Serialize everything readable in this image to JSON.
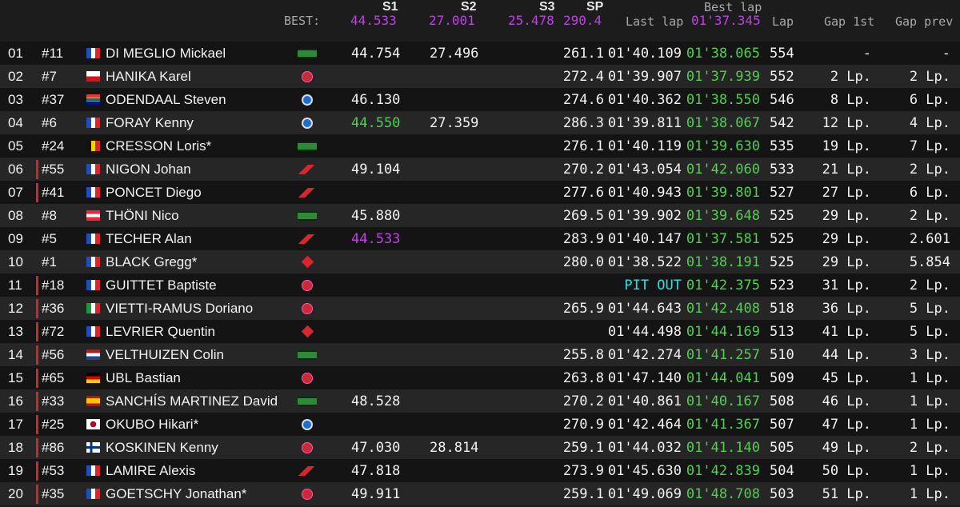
{
  "header": {
    "best_label": "BEST:",
    "s1": {
      "label": "S1",
      "best": "44.533"
    },
    "s2": {
      "label": "S2",
      "best": "27.001"
    },
    "s3": {
      "label": "S3",
      "best": "25.478"
    },
    "sp": {
      "label": "SP",
      "best": "290.4"
    },
    "last_lap_label": "Last lap",
    "best_lap": {
      "label": "Best lap",
      "value": "01'37.345"
    },
    "lap_label": "Lap",
    "gap1_label": "Gap 1st",
    "gapprev_label": "Gap prev"
  },
  "colors": {
    "purple": "#c040e8",
    "green": "#4fd04f",
    "cyan": "#2fe0e0",
    "red_bar": "#d0262a"
  },
  "rows": [
    {
      "pos": "01",
      "num": "#11",
      "red": false,
      "flag": "fr",
      "name": "DI MEGLIO Mickael",
      "brand": "kawasaki",
      "s1": "44.754",
      "s1c": "",
      "s2": "27.496",
      "sp": "261.1",
      "last": "01'40.109",
      "lastc": "",
      "best": "01'38.065",
      "lap": "554",
      "g1": "-",
      "gp": "-"
    },
    {
      "pos": "02",
      "num": "#7",
      "red": false,
      "flag": "cz",
      "name": "HANIKA Karel",
      "brand": "yamaha",
      "s1": "",
      "s1c": "",
      "s2": "",
      "sp": "272.4",
      "last": "01'39.907",
      "lastc": "",
      "best": "01'37.939",
      "lap": "552",
      "g1": "2 Lp.",
      "gp": "2 Lp."
    },
    {
      "pos": "03",
      "num": "#37",
      "red": false,
      "flag": "za",
      "name": "ODENDAAL Steven",
      "brand": "bmw",
      "s1": "46.130",
      "s1c": "",
      "s2": "",
      "sp": "274.6",
      "last": "01'40.362",
      "lastc": "",
      "best": "01'38.550",
      "lap": "546",
      "g1": "8 Lp.",
      "gp": "6 Lp."
    },
    {
      "pos": "04",
      "num": "#6",
      "red": false,
      "flag": "fr",
      "name": "FORAY Kenny",
      "brand": "bmw",
      "s1": "44.550",
      "s1c": "green",
      "s2": "27.359",
      "sp": "286.3",
      "last": "01'39.811",
      "lastc": "",
      "best": "01'38.067",
      "lap": "542",
      "g1": "12 Lp.",
      "gp": "4 Lp."
    },
    {
      "pos": "05",
      "num": "#24",
      "red": false,
      "flag": "be",
      "name": "CRESSON Loris*",
      "brand": "kawasaki",
      "s1": "",
      "s1c": "",
      "s2": "",
      "sp": "276.1",
      "last": "01'40.119",
      "lastc": "",
      "best": "01'39.630",
      "lap": "535",
      "g1": "19 Lp.",
      "gp": "7 Lp."
    },
    {
      "pos": "06",
      "num": "#55",
      "red": true,
      "flag": "fr",
      "name": "NIGON Johan",
      "brand": "honda",
      "s1": "49.104",
      "s1c": "",
      "s2": "",
      "sp": "270.2",
      "last": "01'43.054",
      "lastc": "",
      "best": "01'42.060",
      "lap": "533",
      "g1": "21 Lp.",
      "gp": "2 Lp."
    },
    {
      "pos": "07",
      "num": "#41",
      "red": true,
      "flag": "fr",
      "name": "PONCET Diego",
      "brand": "honda",
      "s1": "",
      "s1c": "",
      "s2": "",
      "sp": "277.6",
      "last": "01'40.943",
      "lastc": "",
      "best": "01'39.801",
      "lap": "527",
      "g1": "27 Lp.",
      "gp": "6 Lp."
    },
    {
      "pos": "08",
      "num": "#8",
      "red": false,
      "flag": "at",
      "name": "THÖNI Nico",
      "brand": "kawasaki",
      "s1": "45.880",
      "s1c": "",
      "s2": "",
      "sp": "269.5",
      "last": "01'39.902",
      "lastc": "",
      "best": "01'39.648",
      "lap": "525",
      "g1": "29 Lp.",
      "gp": "2 Lp."
    },
    {
      "pos": "09",
      "num": "#5",
      "red": false,
      "flag": "fr",
      "name": "TECHER Alan",
      "brand": "honda",
      "s1": "44.533",
      "s1c": "purple",
      "s2": "",
      "sp": "283.9",
      "last": "01'40.147",
      "lastc": "",
      "best": "01'37.581",
      "lap": "525",
      "g1": "29 Lp.",
      "gp": "2.601"
    },
    {
      "pos": "10",
      "num": "#1",
      "red": false,
      "flag": "fr",
      "name": "BLACK Gregg*",
      "brand": "suzuki",
      "s1": "",
      "s1c": "",
      "s2": "",
      "sp": "280.0",
      "last": "01'38.522",
      "lastc": "",
      "best": "01'38.191",
      "lap": "525",
      "g1": "29 Lp.",
      "gp": "5.854"
    },
    {
      "pos": "11",
      "num": "#18",
      "red": true,
      "flag": "fr",
      "name": "GUITTET Baptiste",
      "brand": "yamaha",
      "s1": "",
      "s1c": "",
      "s2": "",
      "sp": "",
      "last": "PIT OUT",
      "lastc": "cyan",
      "best": "01'42.375",
      "lap": "523",
      "g1": "31 Lp.",
      "gp": "2 Lp."
    },
    {
      "pos": "12",
      "num": "#36",
      "red": true,
      "flag": "it",
      "name": "VIETTI-RAMUS Doriano",
      "brand": "yamaha",
      "s1": "",
      "s1c": "",
      "s2": "",
      "sp": "265.9",
      "last": "01'44.643",
      "lastc": "",
      "best": "01'42.408",
      "lap": "518",
      "g1": "36 Lp.",
      "gp": "5 Lp."
    },
    {
      "pos": "13",
      "num": "#72",
      "red": true,
      "flag": "fr",
      "name": "LEVRIER Quentin",
      "brand": "suzuki",
      "s1": "",
      "s1c": "",
      "s2": "",
      "sp": "",
      "last": "01'44.498",
      "lastc": "",
      "best": "01'44.169",
      "lap": "513",
      "g1": "41 Lp.",
      "gp": "5 Lp."
    },
    {
      "pos": "14",
      "num": "#56",
      "red": true,
      "flag": "nl",
      "name": "VELTHUIZEN Colin",
      "brand": "kawasaki",
      "s1": "",
      "s1c": "",
      "s2": "",
      "sp": "255.8",
      "last": "01'42.274",
      "lastc": "",
      "best": "01'41.257",
      "lap": "510",
      "g1": "44 Lp.",
      "gp": "3 Lp."
    },
    {
      "pos": "15",
      "num": "#65",
      "red": true,
      "flag": "de",
      "name": "UBL Bastian",
      "brand": "yamaha",
      "s1": "",
      "s1c": "",
      "s2": "",
      "sp": "263.8",
      "last": "01'47.140",
      "lastc": "",
      "best": "01'44.041",
      "lap": "509",
      "g1": "45 Lp.",
      "gp": "1 Lp."
    },
    {
      "pos": "16",
      "num": "#33",
      "red": true,
      "flag": "es",
      "name": "SANCHÍS MARTINEZ David",
      "brand": "kawasaki",
      "s1": "48.528",
      "s1c": "",
      "s2": "",
      "sp": "270.2",
      "last": "01'40.861",
      "lastc": "",
      "best": "01'40.167",
      "lap": "508",
      "g1": "46 Lp.",
      "gp": "1 Lp."
    },
    {
      "pos": "17",
      "num": "#25",
      "red": true,
      "flag": "jp",
      "name": "OKUBO Hikari*",
      "brand": "bmw",
      "s1": "",
      "s1c": "",
      "s2": "",
      "sp": "270.9",
      "last": "01'42.464",
      "lastc": "",
      "best": "01'41.367",
      "lap": "507",
      "g1": "47 Lp.",
      "gp": "1 Lp."
    },
    {
      "pos": "18",
      "num": "#86",
      "red": true,
      "flag": "fi",
      "name": "KOSKINEN Kenny",
      "brand": "yamaha",
      "s1": "47.030",
      "s1c": "",
      "s2": "28.814",
      "sp": "259.1",
      "last": "01'44.032",
      "lastc": "",
      "best": "01'41.140",
      "lap": "505",
      "g1": "49 Lp.",
      "gp": "2 Lp."
    },
    {
      "pos": "19",
      "num": "#53",
      "red": true,
      "flag": "fr",
      "name": "LAMIRE Alexis",
      "brand": "honda",
      "s1": "47.818",
      "s1c": "",
      "s2": "",
      "sp": "273.9",
      "last": "01'45.630",
      "lastc": "",
      "best": "01'42.839",
      "lap": "504",
      "g1": "50 Lp.",
      "gp": "1 Lp."
    },
    {
      "pos": "20",
      "num": "#35",
      "red": true,
      "flag": "fr",
      "name": "GOETSCHY Jonathan*",
      "brand": "yamaha",
      "s1": "49.911",
      "s1c": "",
      "s2": "",
      "sp": "259.1",
      "last": "01'49.069",
      "lastc": "",
      "best": "01'48.708",
      "lap": "503",
      "g1": "51 Lp.",
      "gp": "1 Lp."
    }
  ]
}
